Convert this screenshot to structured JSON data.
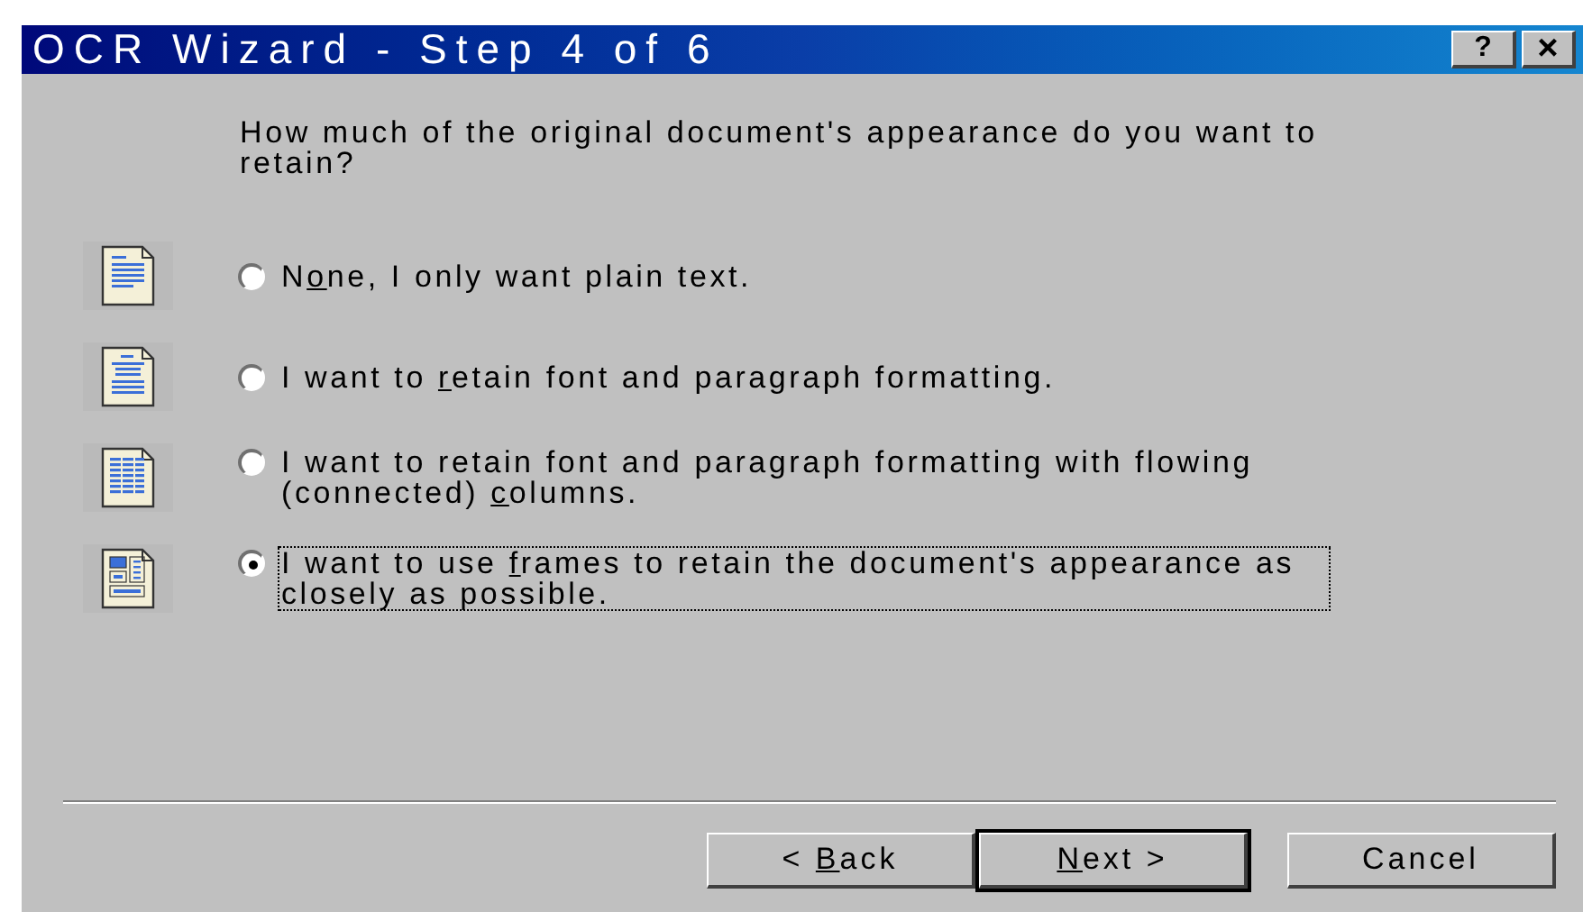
{
  "window": {
    "title": "OCR Wizard - Step 4 of 6",
    "help_button": "?",
    "close_button": "×"
  },
  "question": "How much of the original document's appearance do you want to retain?",
  "options": [
    {
      "kind": "plain",
      "before": "N",
      "key": "o",
      "after": "ne, I only want plain text.",
      "selected": false
    },
    {
      "kind": "paragraph",
      "before": "I want to ",
      "key": "r",
      "after": "etain font and paragraph formatting.",
      "selected": false
    },
    {
      "kind": "columns",
      "before": "I want to retain font and paragraph formatting with flowing (connected) ",
      "key": "c",
      "after": "olumns.",
      "selected": false
    },
    {
      "kind": "frames",
      "before": "I want to use ",
      "key": "f",
      "after": "rames to retain the document's appearance as closely as possible.",
      "selected": true
    }
  ],
  "buttons": [
    {
      "before": "< ",
      "key": "B",
      "after": "ack",
      "default": false
    },
    {
      "key": "N",
      "after": "ext >",
      "default": true
    },
    {
      "before": "Cancel",
      "default": false
    }
  ]
}
